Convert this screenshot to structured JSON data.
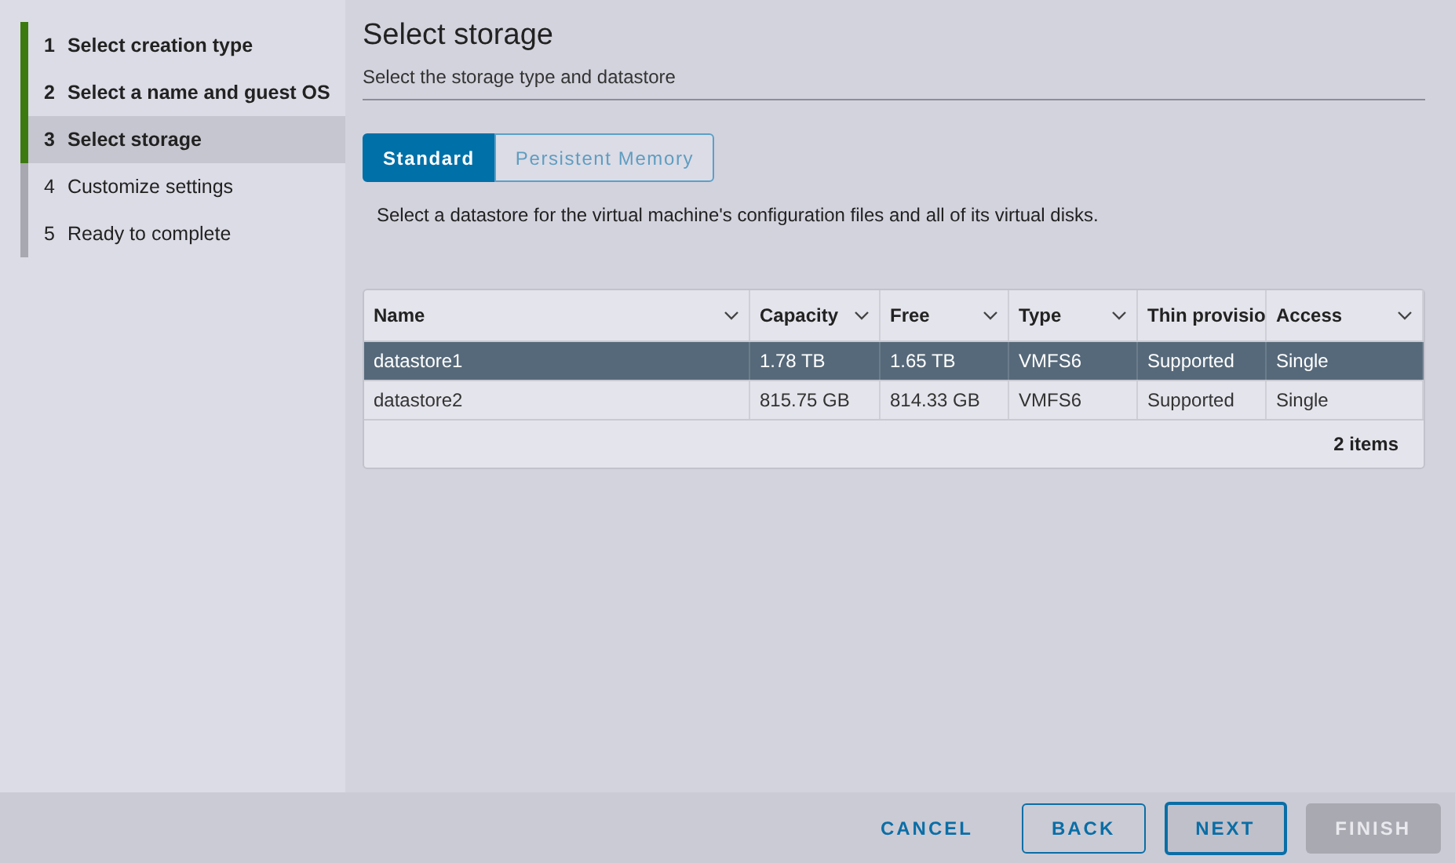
{
  "steps": [
    {
      "number": "1",
      "label": "Select creation type",
      "completed": true,
      "selected": false
    },
    {
      "number": "2",
      "label": "Select a name and guest OS",
      "completed": true,
      "selected": false
    },
    {
      "number": "3",
      "label": "Select storage",
      "completed": true,
      "selected": true
    },
    {
      "number": "4",
      "label": "Customize settings",
      "completed": false,
      "selected": false
    },
    {
      "number": "5",
      "label": "Ready to complete",
      "completed": false,
      "selected": false
    }
  ],
  "page": {
    "title": "Select storage",
    "subtitle": "Select the storage type and datastore"
  },
  "tabs": [
    {
      "label": "Standard",
      "selected": true
    },
    {
      "label": "Persistent Memory",
      "selected": false
    }
  ],
  "description": "Select a datastore for the virtual machine's configuration files and all of its virtual disks.",
  "table": {
    "columns": [
      "Name",
      "Capacity",
      "Free",
      "Type",
      "Thin provisio",
      "Access"
    ],
    "rows": [
      {
        "cells": [
          "datastore1",
          "1.78 TB",
          "1.65 TB",
          "VMFS6",
          "Supported",
          "Single"
        ],
        "selected": true
      },
      {
        "cells": [
          "datastore2",
          "815.75 GB",
          "814.33 GB",
          "VMFS6",
          "Supported",
          "Single"
        ],
        "selected": false
      }
    ],
    "footer": "2 items"
  },
  "buttons": [
    {
      "label": "CANCEL",
      "kind": "flat",
      "focused": false,
      "disabled": false
    },
    {
      "label": "BACK",
      "kind": "outline",
      "focused": false,
      "disabled": false
    },
    {
      "label": "NEXT",
      "kind": "outline",
      "focused": true,
      "disabled": false
    },
    {
      "label": "FINISH",
      "kind": "solid",
      "focused": false,
      "disabled": true
    }
  ]
}
